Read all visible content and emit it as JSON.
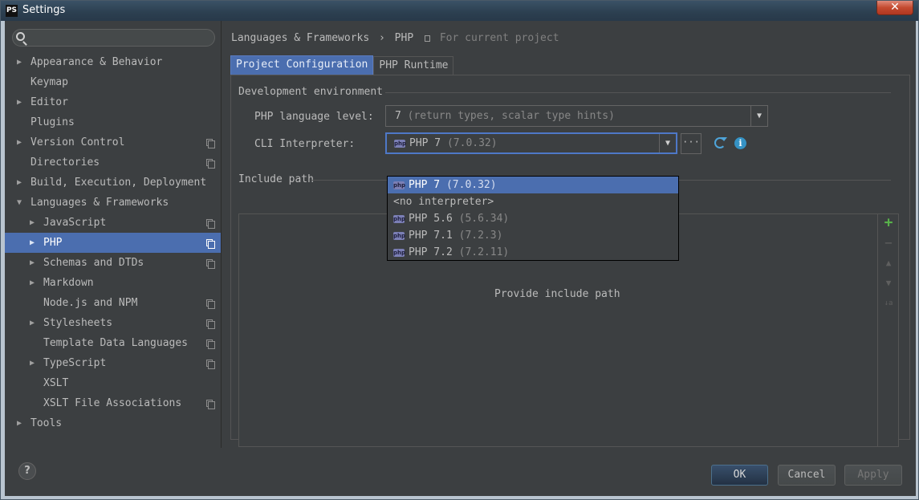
{
  "window": {
    "title": "Settings",
    "app_icon": "PS",
    "close_glyph": "✕"
  },
  "sidebar": {
    "items": [
      {
        "label": "Appearance & Behavior",
        "level": 0,
        "arrow": "▶",
        "copy": false
      },
      {
        "label": "Keymap",
        "level": 0,
        "arrow": "",
        "copy": false
      },
      {
        "label": "Editor",
        "level": 0,
        "arrow": "▶",
        "copy": false
      },
      {
        "label": "Plugins",
        "level": 0,
        "arrow": "",
        "copy": false
      },
      {
        "label": "Version Control",
        "level": 0,
        "arrow": "▶",
        "copy": true
      },
      {
        "label": "Directories",
        "level": 0,
        "arrow": "",
        "copy": true
      },
      {
        "label": "Build, Execution, Deployment",
        "level": 0,
        "arrow": "▶",
        "copy": false
      },
      {
        "label": "Languages & Frameworks",
        "level": 0,
        "arrow": "▼",
        "copy": false
      },
      {
        "label": "JavaScript",
        "level": 1,
        "arrow": "▶",
        "copy": true
      },
      {
        "label": "PHP",
        "level": 1,
        "arrow": "▶",
        "copy": true,
        "selected": true
      },
      {
        "label": "Schemas and DTDs",
        "level": 1,
        "arrow": "▶",
        "copy": true
      },
      {
        "label": "Markdown",
        "level": 1,
        "arrow": "▶",
        "copy": false
      },
      {
        "label": "Node.js and NPM",
        "level": 1,
        "arrow": "",
        "copy": true
      },
      {
        "label": "Stylesheets",
        "level": 1,
        "arrow": "▶",
        "copy": true
      },
      {
        "label": "Template Data Languages",
        "level": 1,
        "arrow": "",
        "copy": true
      },
      {
        "label": "TypeScript",
        "level": 1,
        "arrow": "▶",
        "copy": true
      },
      {
        "label": "XSLT",
        "level": 1,
        "arrow": "",
        "copy": false
      },
      {
        "label": "XSLT File Associations",
        "level": 1,
        "arrow": "",
        "copy": true
      },
      {
        "label": "Tools",
        "level": 0,
        "arrow": "▶",
        "copy": false
      }
    ]
  },
  "breadcrumb": {
    "parent": "Languages & Frameworks",
    "separator": "›",
    "current": "PHP",
    "scope": "For current project"
  },
  "tabs": [
    {
      "label": "Project Configuration",
      "active": true
    },
    {
      "label": "PHP Runtime",
      "active": false
    }
  ],
  "dev_env": {
    "title": "Development environment",
    "language_level_label": "PHP language level:",
    "language_level_value": "7",
    "language_level_hint": "(return types, scalar type hints)",
    "cli_label": "CLI Interpreter:",
    "cli_value": "PHP 7",
    "cli_version": "(7.0.32)",
    "dots_label": "···"
  },
  "interpreter_options": [
    {
      "name": "PHP 7",
      "version": "(7.0.32)",
      "icon": true,
      "selected": true
    },
    {
      "name": "<no interpreter>",
      "version": "",
      "icon": false,
      "selected": false
    },
    {
      "name": "PHP 5.6",
      "version": "(5.6.34)",
      "icon": true,
      "selected": false
    },
    {
      "name": "PHP 7.1",
      "version": "(7.2.3)",
      "icon": true,
      "selected": false
    },
    {
      "name": "PHP 7.2",
      "version": "(7.2.11)",
      "icon": true,
      "selected": false
    }
  ],
  "include_path": {
    "title": "Include path",
    "empty_text": "Provide include path",
    "tools": {
      "add": "+",
      "remove": "−",
      "up": "▲",
      "down": "▼",
      "sort": "↓a"
    }
  },
  "buttons": {
    "help": "?",
    "ok": "OK",
    "cancel": "Cancel",
    "apply": "Apply"
  },
  "colors": {
    "accent": "#4b6eaf",
    "panel": "#3c3f41",
    "add_green": "#58b24a",
    "info_blue": "#3592c4"
  },
  "php_icon_text": "php"
}
